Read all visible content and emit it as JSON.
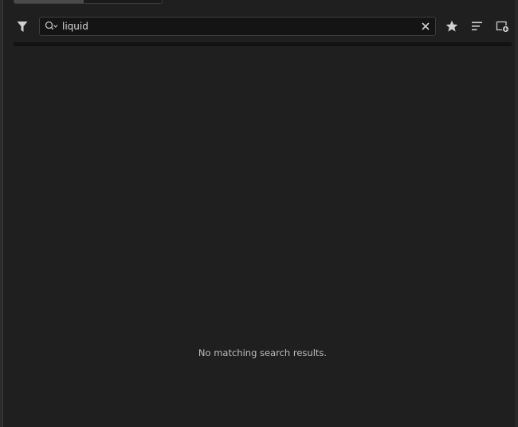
{
  "toolbar": {
    "filter_icon": "filter-icon",
    "search": {
      "value": "liquid",
      "icon": "search-icon",
      "clear_icon": "close-icon"
    },
    "favorites_icon": "star-icon",
    "sort_icon": "sort-icon",
    "new_bin_icon": "new-bin-icon"
  },
  "results": {
    "empty_message": "No matching search results."
  },
  "colors": {
    "background": "#1f1f1f",
    "search_bg": "#141414",
    "icon": "#d0d0d0",
    "text": "#bdbdbd"
  }
}
